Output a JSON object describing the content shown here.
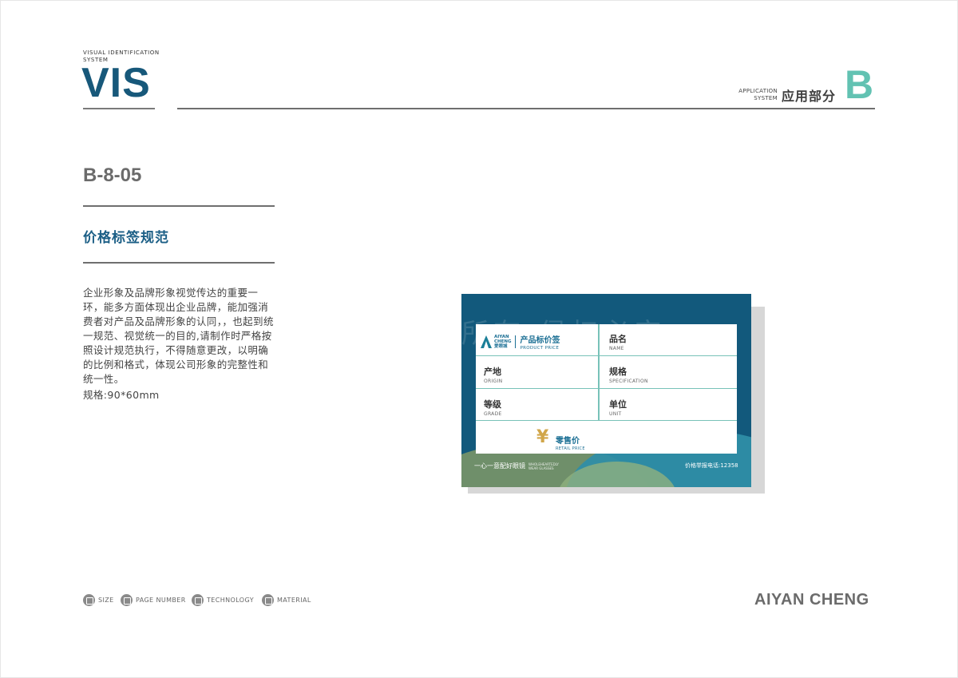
{
  "header": {
    "vis_small": "VISUAL IDENTIFICATION SYSTEM",
    "vis_big": "VIS",
    "section_small": "APPLICATION SYSTEM",
    "section_cn": "应用部分",
    "section_letter": "B"
  },
  "left": {
    "code": "B-8-05",
    "title": "价格标签规范",
    "description": "企业形象及品牌形象视觉传达的重要一环，能多方面体现出企业品牌，能加强消费者对产品及品牌形象的认同，，也起到统一规范、视觉统一的目的,请制作时严格按照设计规范执行，不得随意更改，以明确的比例和格式，体现公司形象的完整性和统一性。",
    "spec": "规格:90*60mm"
  },
  "tag": {
    "watermark": "所有 侵权必究",
    "logo_line1": "AIYAN",
    "logo_line2": "CHENG",
    "logo_line3": "爱眼城",
    "title_cn": "产品标价签",
    "title_en": "PRODUCT PRICE",
    "name_cn": "品名",
    "name_en": "NAME",
    "origin_cn": "产地",
    "origin_en": "ORIGIN",
    "spec_cn": "规格",
    "spec_en": "SPECIFICATION",
    "grade_cn": "等级",
    "grade_en": "GRADE",
    "unit_cn": "单位",
    "unit_en": "UNIT",
    "yen": "¥",
    "retail_cn": "零售价",
    "retail_en": "RETAIL PRICE",
    "slogan_cn": "一心一意配好眼镜",
    "slogan_en": "WHOLEHEARTEDLY WEAR GLASSES",
    "hotline": "价格举报电话:12358",
    "colors": {
      "navy": "#12597c",
      "teal": "#2f8ea6",
      "green": "#6f8f6a",
      "gold": "#d1a64a"
    }
  },
  "footer": {
    "items": [
      "SIZE",
      "PAGE NUMBER",
      "TECHNOLOGY",
      "MATERIAL"
    ],
    "brand": "AIYAN CHENG"
  }
}
